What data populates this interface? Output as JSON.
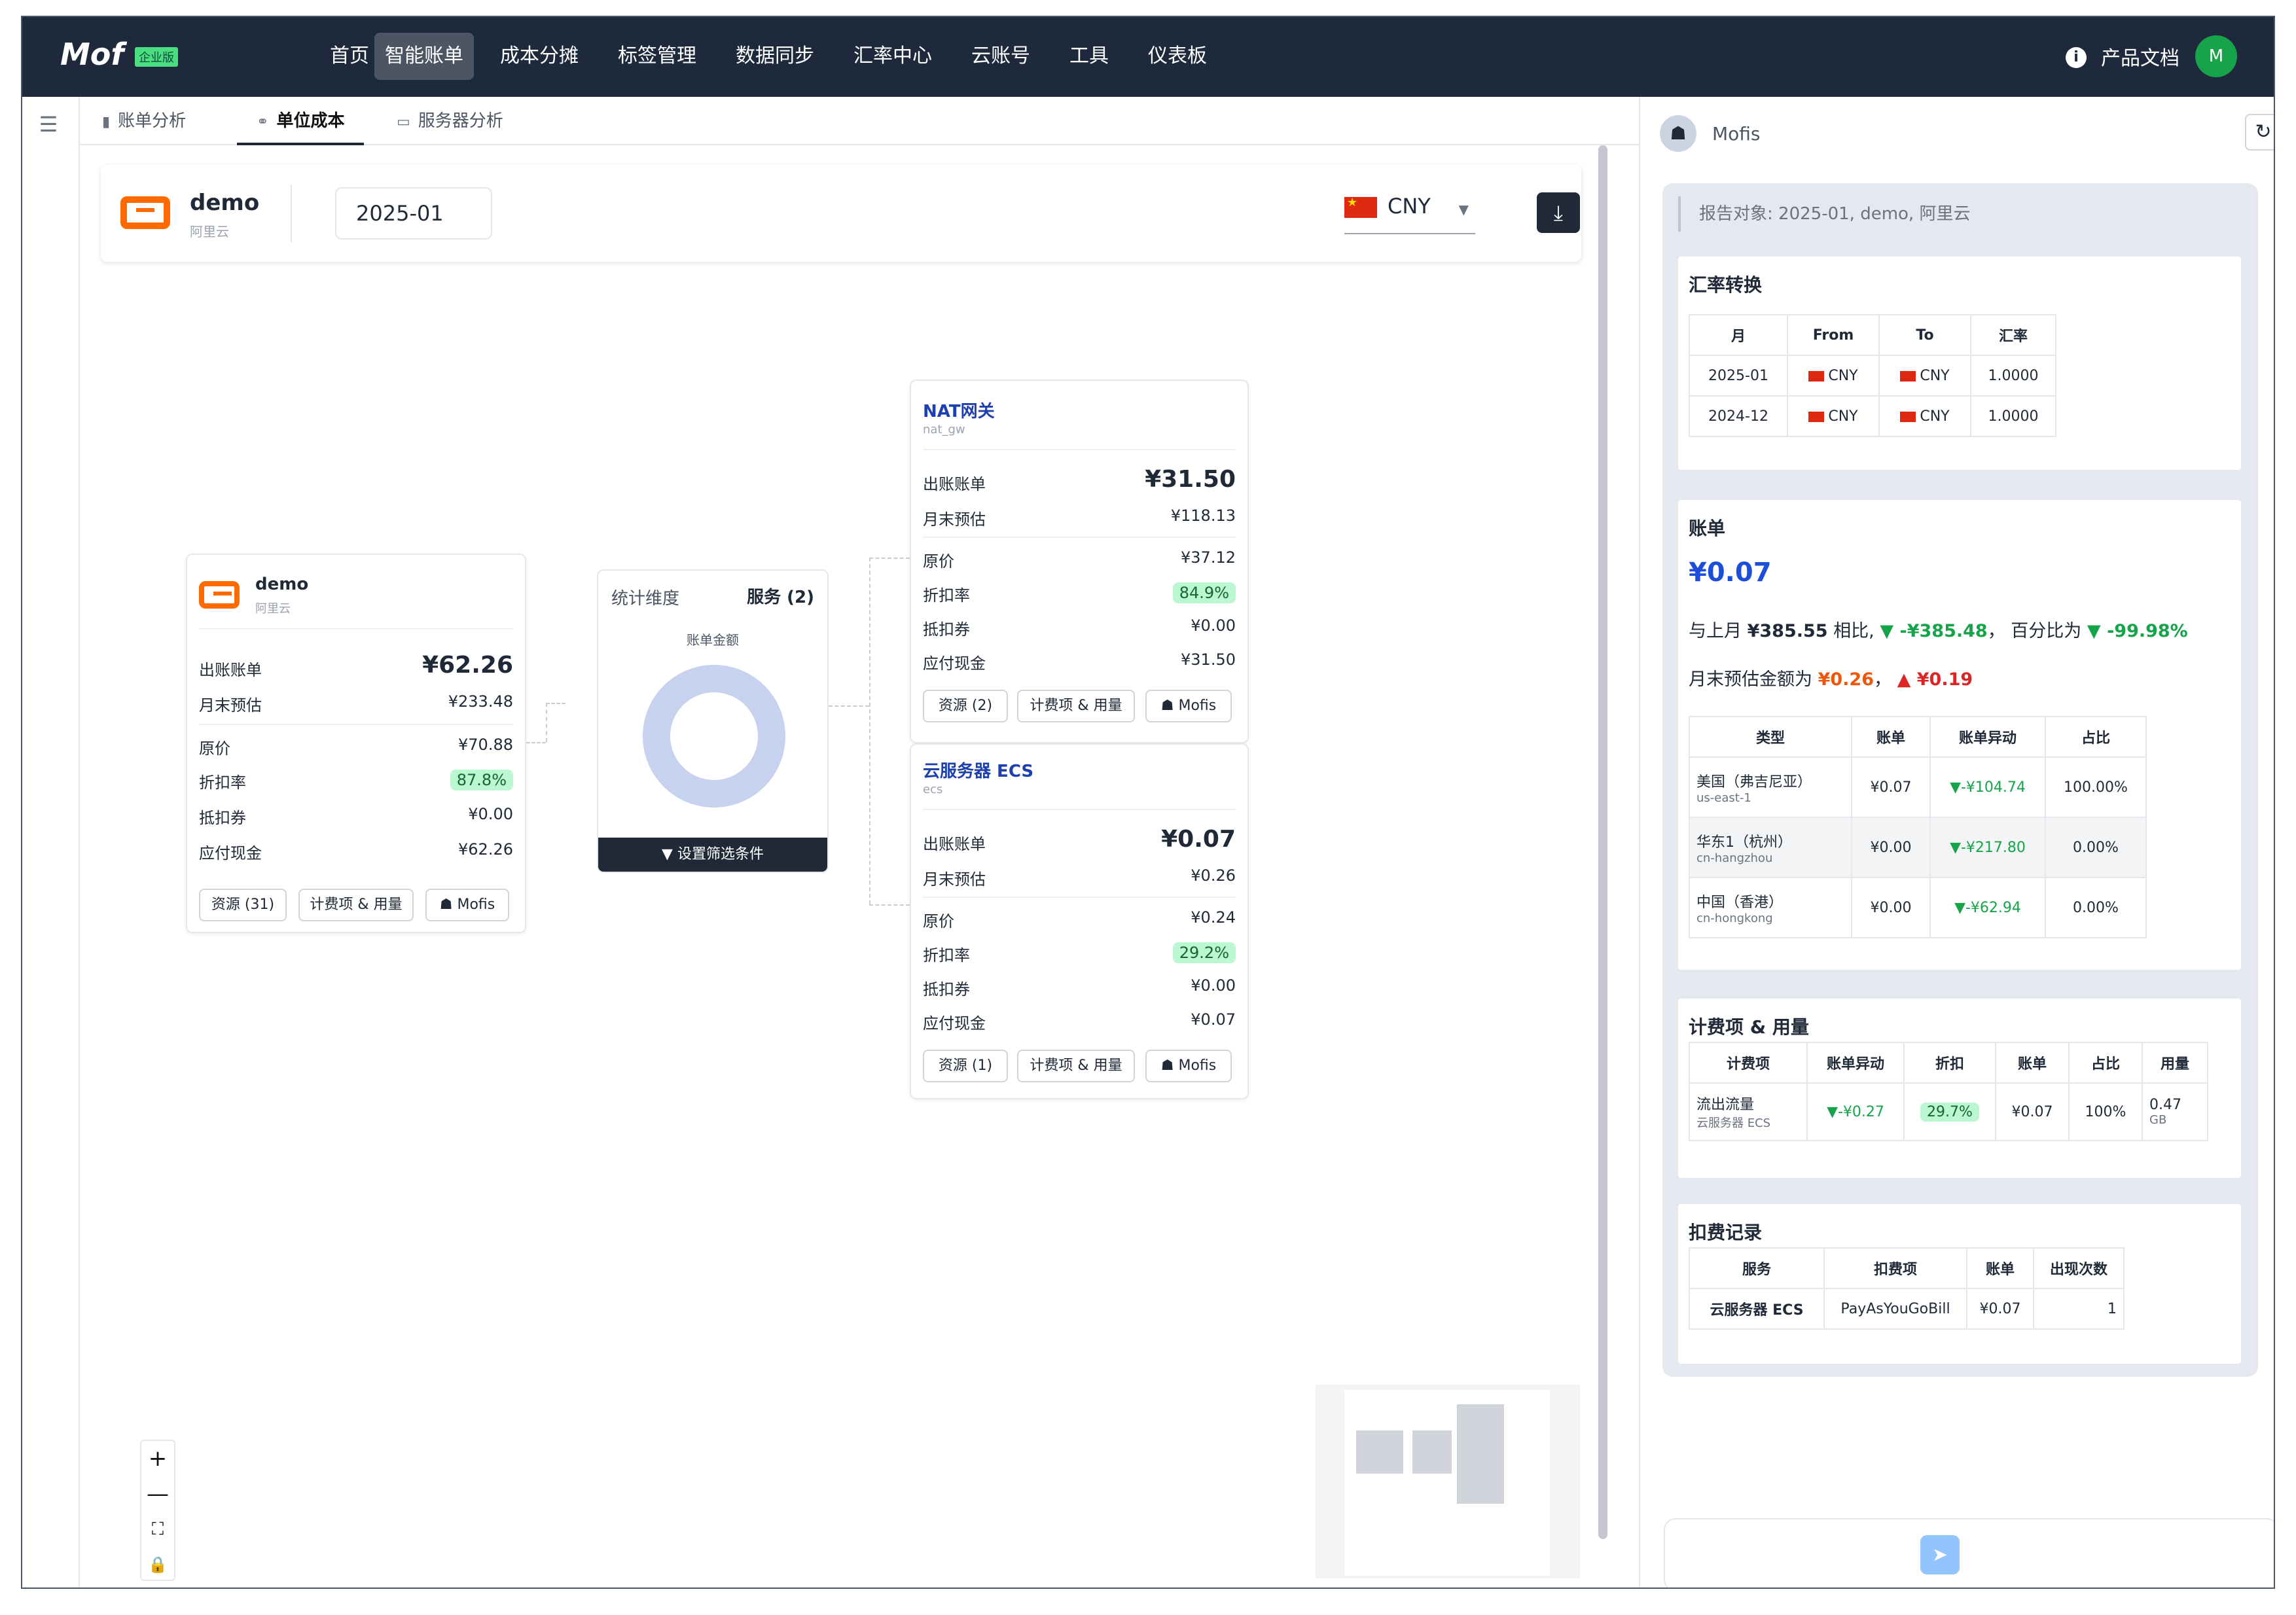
{
  "app": {
    "logo": "Mof",
    "edition": "企业版"
  },
  "nav": [
    "首页",
    "智能账单",
    "成本分摊",
    "标签管理",
    "数据同步",
    "汇率中心",
    "云账号",
    "工具",
    "仪表板"
  ],
  "nav_active": 1,
  "header_right": {
    "docs": "产品文档",
    "avatar": "M"
  },
  "tabs": [
    "账单分析",
    "单位成本",
    "服务器分析"
  ],
  "tab_active": 1,
  "toolbar": {
    "account": "demo",
    "provider": "阿里云",
    "month": "2025-01",
    "currency": "CNY"
  },
  "root_node": {
    "name": "demo",
    "provider": "阿里云",
    "rows": [
      [
        "出账账单",
        "¥62.26"
      ],
      [
        "月末预估",
        "¥233.48"
      ],
      [
        "原价",
        "¥70.88"
      ],
      [
        "折扣率",
        "87.8%"
      ],
      [
        "抵扣券",
        "¥0.00"
      ],
      [
        "应付现金",
        "¥62.26"
      ]
    ],
    "buttons": [
      "资源 (31)",
      "计费项 & 用量",
      "Mofis"
    ]
  },
  "dimension": {
    "label": "统计维度",
    "value": "服务 (2)",
    "chart_label": "账单金额",
    "filter_button": "设置筛选条件"
  },
  "services": [
    {
      "name": "NAT网关",
      "code": "nat_gw",
      "rows": [
        [
          "出账账单",
          "¥31.50"
        ],
        [
          "月末预估",
          "¥118.13"
        ],
        [
          "原价",
          "¥37.12"
        ],
        [
          "折扣率",
          "84.9%"
        ],
        [
          "抵扣券",
          "¥0.00"
        ],
        [
          "应付现金",
          "¥31.50"
        ]
      ],
      "buttons": [
        "资源 (2)",
        "计费项 & 用量",
        "Mofis"
      ]
    },
    {
      "name": "云服务器 ECS",
      "code": "ecs",
      "rows": [
        [
          "出账账单",
          "¥0.07"
        ],
        [
          "月末预估",
          "¥0.26"
        ],
        [
          "原价",
          "¥0.24"
        ],
        [
          "折扣率",
          "29.2%"
        ],
        [
          "抵扣券",
          "¥0.00"
        ],
        [
          "应付现金",
          "¥0.07"
        ]
      ],
      "buttons": [
        "资源 (1)",
        "计费项 & 用量",
        "Mofis"
      ]
    }
  ],
  "zoom": [
    "+",
    "—",
    "⛶",
    "🔒"
  ],
  "panel": {
    "title": "Mofis",
    "report_target": "报告对象: 2025-01, demo, 阿里云",
    "fx": {
      "title": "汇率转换",
      "headers": [
        "月",
        "From",
        "To",
        "汇率"
      ],
      "rows": [
        [
          "2025-01",
          "CNY",
          "CNY",
          "1.0000"
        ],
        [
          "2024-12",
          "CNY",
          "CNY",
          "1.0000"
        ]
      ]
    },
    "bill": {
      "title": "账单",
      "amount": "¥0.07",
      "compare_prefix": "与上月",
      "last_month": "¥385.55",
      "compare_mid": "相比,",
      "delta": "▼ -¥385.48",
      "pct_prefix": "， 百分比为",
      "pct": "▼ -99.98%",
      "forecast_prefix": "月末预估金额为",
      "forecast": "¥0.26",
      "forecast_sep": "，",
      "forecast_delta": "▲ ¥0.19",
      "headers": [
        "类型",
        "账单",
        "账单异动",
        "占比"
      ],
      "rows": [
        [
          "美国（弗吉尼亚）",
          "us-east-1",
          "¥0.07",
          "▼-¥104.74",
          "100.00%"
        ],
        [
          "华东1（杭州）",
          "cn-hangzhou",
          "¥0.00",
          "▼-¥217.80",
          "0.00%"
        ],
        [
          "中国（香港）",
          "cn-hongkong",
          "¥0.00",
          "▼-¥62.94",
          "0.00%"
        ]
      ]
    },
    "items": {
      "title": "计费项 & 用量",
      "headers": [
        "计费项",
        "账单异动",
        "折扣",
        "账单",
        "占比",
        "用量"
      ],
      "row": {
        "name": "流出流量",
        "service": "云服务器 ECS",
        "delta": "▼-¥0.27",
        "discount": "29.7%",
        "bill": "¥0.07",
        "share": "100%",
        "usage": "0.47",
        "unit": "GB"
      }
    },
    "deduct": {
      "title": "扣费记录",
      "headers": [
        "服务",
        "扣费项",
        "账单",
        "出现次数"
      ],
      "row": [
        "云服务器 ECS",
        "PayAsYouGoBill",
        "¥0.07",
        "1"
      ]
    }
  },
  "colors": {
    "nav_bg": "#1e2a3b",
    "accent_green": "#16a34a",
    "aliyun_orange": "#ff6a00",
    "donut": "#c7d2ee"
  }
}
